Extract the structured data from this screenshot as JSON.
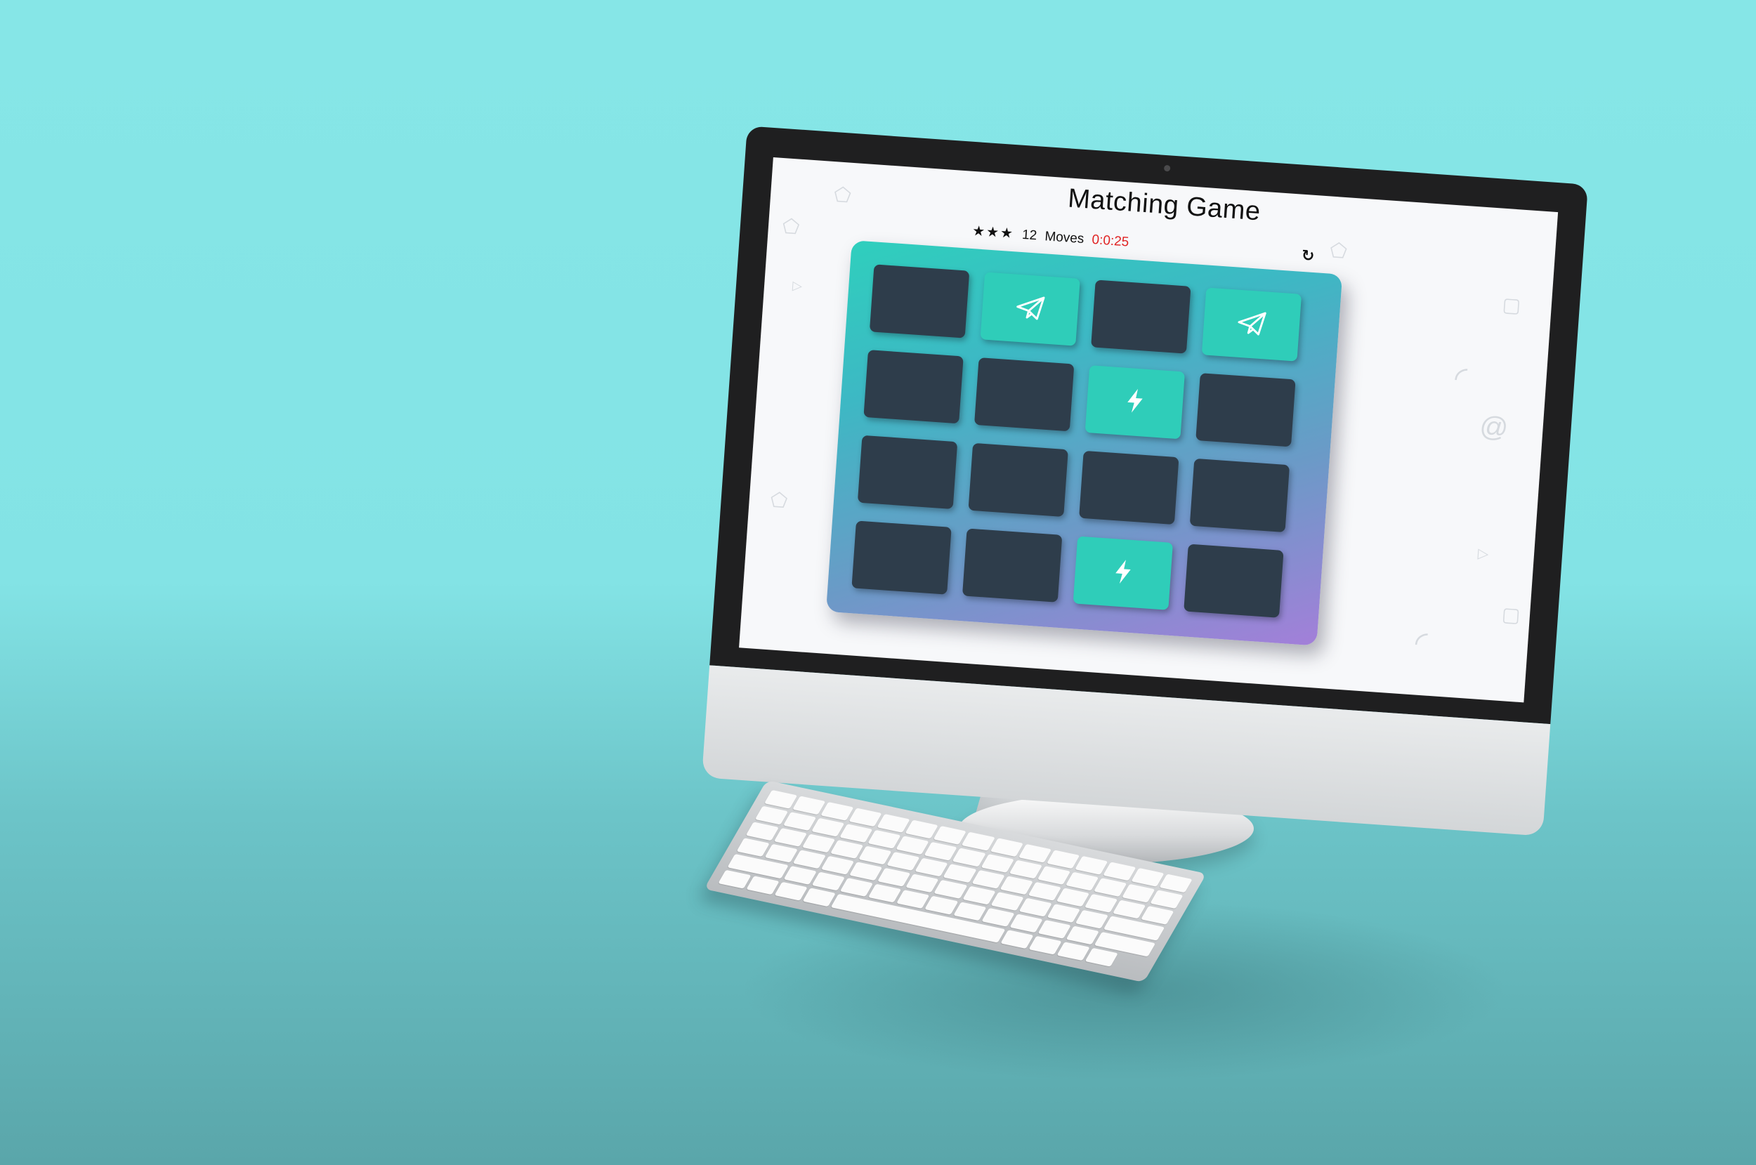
{
  "game": {
    "title": "Matching Game",
    "stars": "★★★",
    "moves_count": "12",
    "moves_label": "Moves",
    "timer": "0:0:25",
    "restart_icon": "↻"
  },
  "deck": {
    "cards": [
      {
        "state": "closed",
        "icon": ""
      },
      {
        "state": "open",
        "icon": "paper-plane-icon"
      },
      {
        "state": "closed",
        "icon": ""
      },
      {
        "state": "open",
        "icon": "paper-plane-icon"
      },
      {
        "state": "closed",
        "icon": ""
      },
      {
        "state": "closed",
        "icon": ""
      },
      {
        "state": "open",
        "icon": "bolt-icon"
      },
      {
        "state": "closed",
        "icon": ""
      },
      {
        "state": "closed",
        "icon": ""
      },
      {
        "state": "closed",
        "icon": ""
      },
      {
        "state": "closed",
        "icon": ""
      },
      {
        "state": "closed",
        "icon": ""
      },
      {
        "state": "closed",
        "icon": ""
      },
      {
        "state": "closed",
        "icon": ""
      },
      {
        "state": "open",
        "icon": "bolt-icon"
      },
      {
        "state": "closed",
        "icon": ""
      }
    ]
  },
  "colors": {
    "card_closed": "#2e3d4b",
    "card_open": "#2fcdb9",
    "timer": "#e02424",
    "background": "#86e6e7"
  }
}
